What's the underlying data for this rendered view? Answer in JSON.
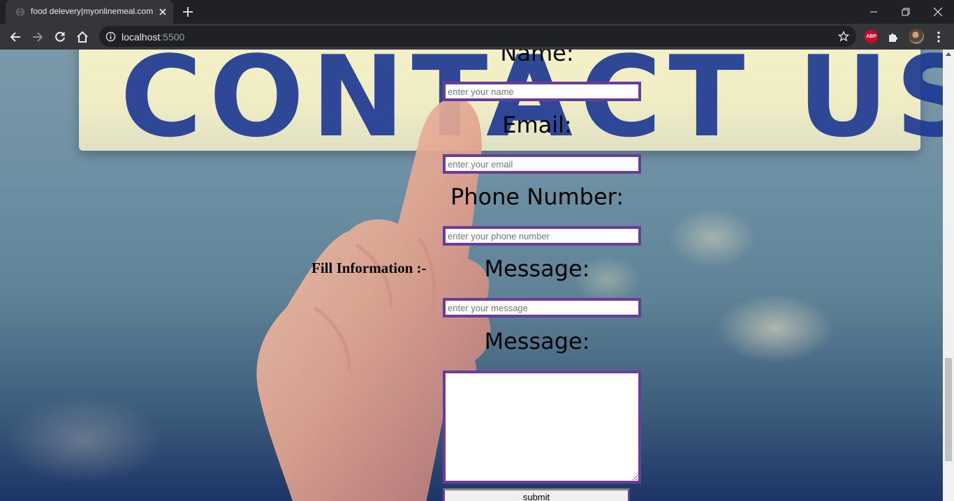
{
  "browser": {
    "tab_title": "food delevery|myonlinemeal.com",
    "url_host": "localhost",
    "url_port": ":5500",
    "abp_label": "ABP",
    "icons": [
      "globe-icon",
      "close-icon",
      "plus-icon",
      "minimize-icon",
      "restore-icon",
      "close-window-icon",
      "back-icon",
      "forward-icon",
      "reload-icon",
      "home-icon",
      "info-icon",
      "star-icon",
      "puzzle-icon",
      "more-icon"
    ]
  },
  "page": {
    "background_sign_text": "CONTACT US",
    "side_label": "Fill Information :-",
    "form": {
      "name_label": "Name:",
      "name_placeholder": "enter your name",
      "email_label": "Email:",
      "email_placeholder": "enter your email",
      "phone_label": "Phone Number:",
      "phone_placeholder": "enter your phone number",
      "message_label": "Message:",
      "message_placeholder": "enter your message",
      "message2_label": "Message:",
      "submit_label": "submit"
    },
    "colors": {
      "input_border": "#6a3d9a",
      "sign_text": "#1f3a93"
    }
  }
}
